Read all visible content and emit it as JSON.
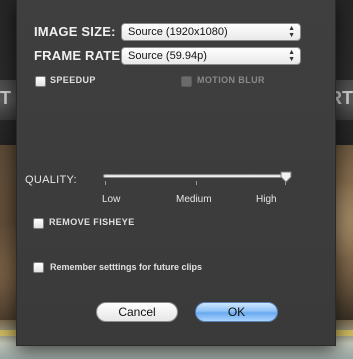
{
  "background": {
    "left_fragment": "T",
    "right_fragment": "ORT"
  },
  "dialog": {
    "image_size": {
      "label": "IMAGE SIZE:",
      "value": "Source (1920x1080)"
    },
    "frame_rate": {
      "label": "FRAME RATE:",
      "value": "Source (59.94p)"
    },
    "speedup": {
      "label": "SPEEDUP",
      "checked": false
    },
    "motion_blur": {
      "label": "MOTION BLUR",
      "checked": false,
      "enabled": false
    },
    "quality": {
      "label": "QUALITY:",
      "ticks": [
        "Low",
        "Medium",
        "High"
      ],
      "selected": "High",
      "level": 1.0
    },
    "remove_fisheye": {
      "label": "REMOVE FISHEYE",
      "checked": false
    },
    "remember": {
      "label": "Remember setttings for future clips",
      "checked": false
    },
    "buttons": {
      "cancel": "Cancel",
      "ok": "OK"
    }
  }
}
